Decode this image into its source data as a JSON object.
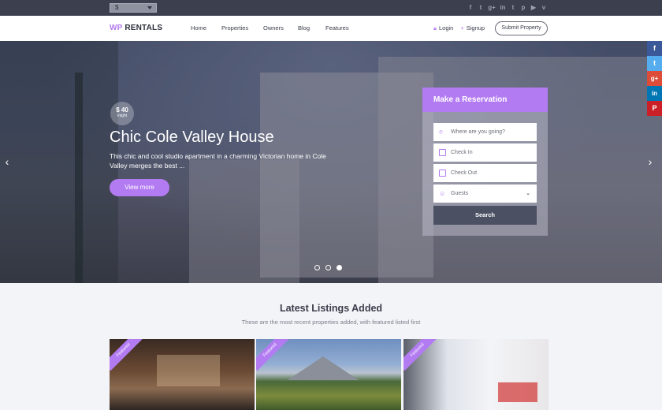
{
  "topbar": {
    "currency": "$",
    "socials": [
      {
        "icon": "facebook-icon",
        "glyph": "f"
      },
      {
        "icon": "twitter-icon",
        "glyph": "t"
      },
      {
        "icon": "google-plus-icon",
        "glyph": "g+"
      },
      {
        "icon": "linkedin-icon",
        "glyph": "in"
      },
      {
        "icon": "tumblr-icon",
        "glyph": "t"
      },
      {
        "icon": "pinterest-icon",
        "glyph": "p"
      },
      {
        "icon": "youtube-icon",
        "glyph": "▶"
      },
      {
        "icon": "vimeo-icon",
        "glyph": "v"
      }
    ]
  },
  "nav": {
    "logo_wp": "WP",
    "logo_rentals": "RENTALS",
    "menu": [
      "Home",
      "Properties",
      "Owners",
      "Blog",
      "Features"
    ],
    "login": "Login",
    "signup": "Signup",
    "submit": "Submit Property"
  },
  "hero": {
    "price": "$ 40",
    "price_unit": "/night",
    "title": "Chic Cole Valley House",
    "description": "This chic and cool studio apartment in a charming Victorian home in Cole Valley merges the best ...",
    "cta": "View more",
    "slide_count": 3,
    "active_slide": 3
  },
  "reservation": {
    "title": "Make a Reservation",
    "where_placeholder": "Where are you going?",
    "checkin_placeholder": "Check In",
    "checkout_placeholder": "Check Out",
    "guests_label": "Guests",
    "search": "Search"
  },
  "share_bar": [
    {
      "icon": "facebook-icon",
      "glyph": "f",
      "color": "#3b5998"
    },
    {
      "icon": "twitter-icon",
      "glyph": "t",
      "color": "#55acee"
    },
    {
      "icon": "google-plus-icon",
      "glyph": "g+",
      "color": "#dd4b39"
    },
    {
      "icon": "linkedin-icon",
      "glyph": "in",
      "color": "#0077b5"
    },
    {
      "icon": "pinterest-icon",
      "glyph": "P",
      "color": "#cb2027"
    }
  ],
  "listings": {
    "title": "Latest Listings Added",
    "subtitle": "These are the most recent properties added, with featured listed first",
    "cards": [
      {
        "badge": "Featured"
      },
      {
        "badge": "Featured"
      },
      {
        "badge": "Featured"
      }
    ]
  },
  "colors": {
    "accent": "#b37bf2",
    "topbar": "#3b3f4e",
    "search_button": "#4b5063"
  }
}
